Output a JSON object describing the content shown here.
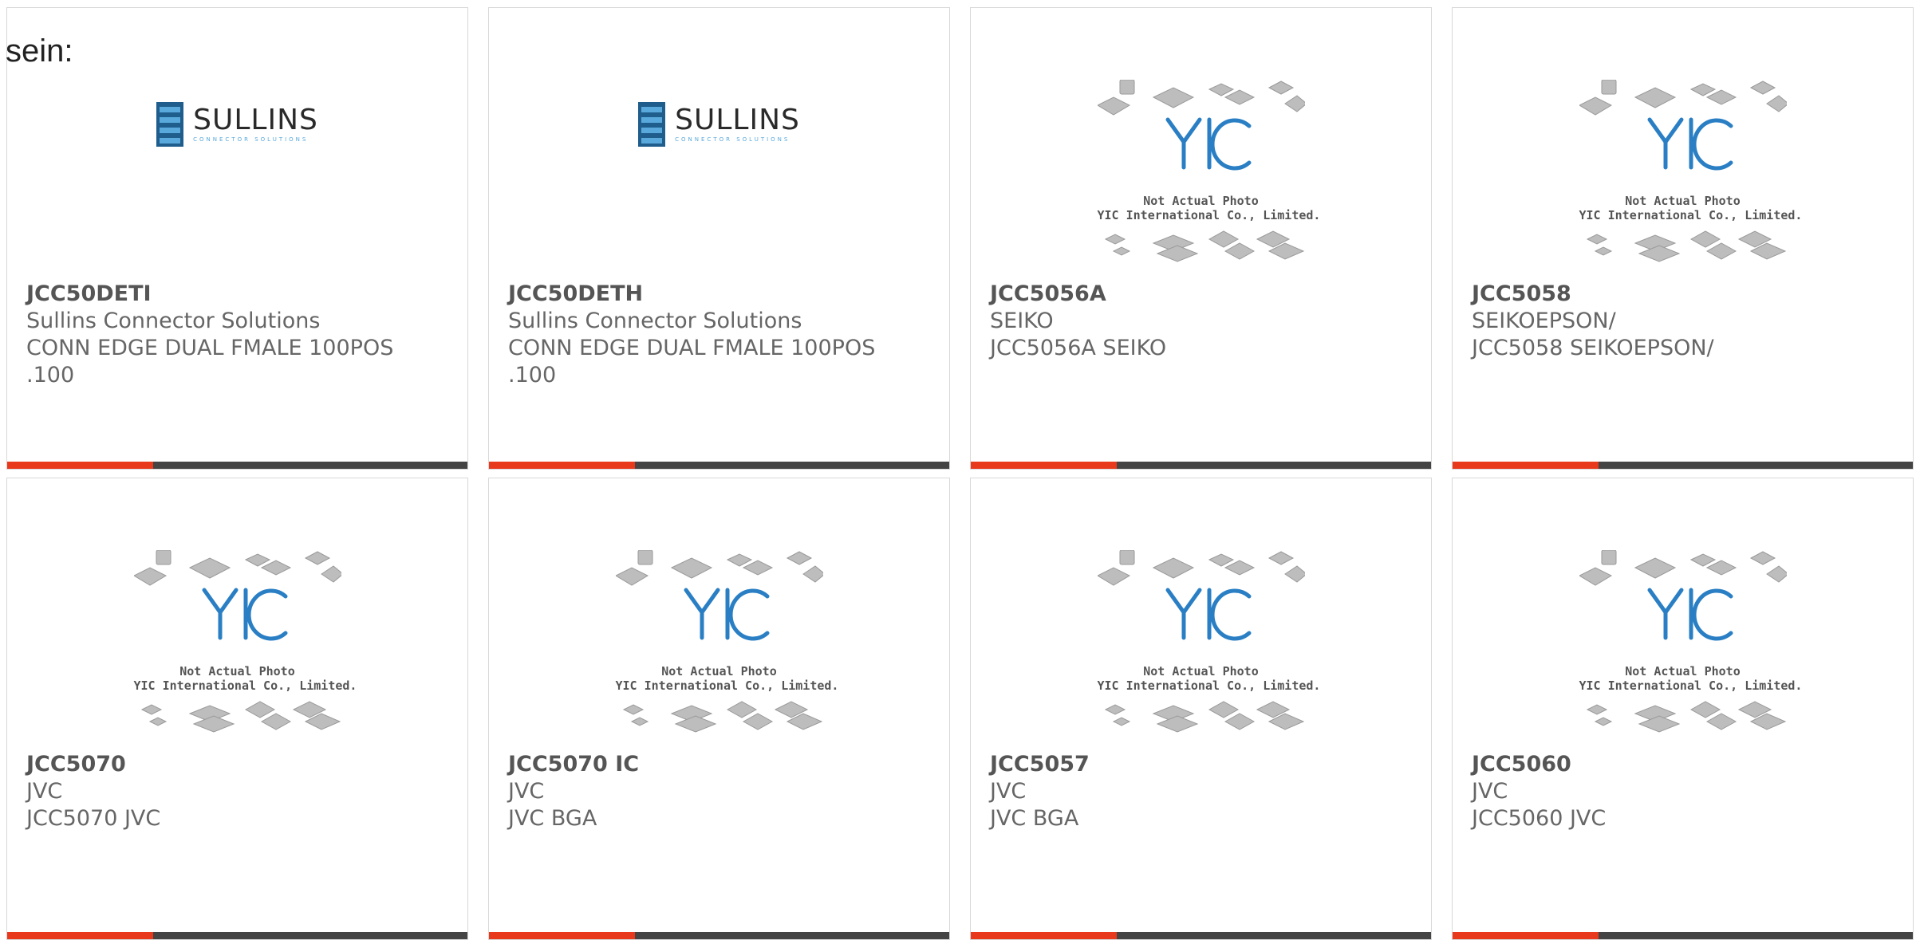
{
  "intro_text": "sein:",
  "colors": {
    "accent": "#e8391d",
    "bar": "#444444",
    "yic_blue": "#2a7fc4",
    "sullins_blue": "#1e5d8c"
  },
  "logos": {
    "sullins": {
      "wordmark": "SULLINS",
      "tagline": "CONNECTOR SOLUTIONS"
    },
    "yic": {
      "mark": "YIC",
      "line1": "Not Actual Photo",
      "line2": "YIC International Co., Limited."
    }
  },
  "products": [
    {
      "part": "JCC50DETI",
      "maker": "Sullins Connector Solutions",
      "desc": "CONN EDGE DUAL FMALE 100POS .100",
      "image": "sullins-logo"
    },
    {
      "part": "JCC50DETH",
      "maker": "Sullins Connector Solutions",
      "desc": "CONN EDGE DUAL FMALE 100POS .100",
      "image": "sullins-logo"
    },
    {
      "part": "JCC5056A",
      "maker": "SEIKO",
      "desc": "JCC5056A SEIKO",
      "image": "yic-placeholder"
    },
    {
      "part": "JCC5058",
      "maker": "SEIKOEPSON/",
      "desc": "JCC5058 SEIKOEPSON/",
      "image": "yic-placeholder"
    },
    {
      "part": "JCC5070",
      "maker": "JVC",
      "desc": "JCC5070 JVC",
      "image": "yic-placeholder"
    },
    {
      "part": "JCC5070 IC",
      "maker": "JVC",
      "desc": "JVC BGA",
      "image": "yic-placeholder"
    },
    {
      "part": "JCC5057",
      "maker": "JVC",
      "desc": "JVC BGA",
      "image": "yic-placeholder"
    },
    {
      "part": "JCC5060",
      "maker": "JVC",
      "desc": "JCC5060 JVC",
      "image": "yic-placeholder"
    }
  ]
}
